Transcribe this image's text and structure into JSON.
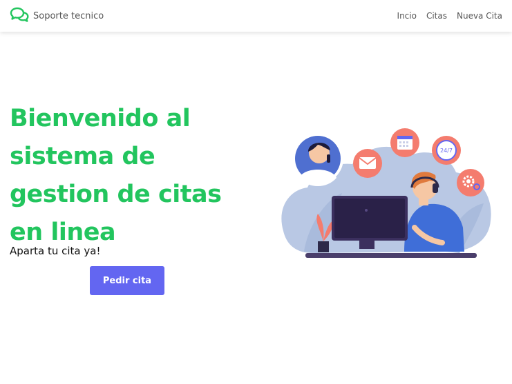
{
  "navbar": {
    "brand_icon": "chat-bubbles-icon",
    "brand_text": "Soporte tecnico",
    "links": [
      "Incio",
      "Citas",
      "Nueva Cita"
    ]
  },
  "hero": {
    "title": "Bienvenido al sistema de gestion de citas en linea",
    "subtitle": "Aparta tu cita ya!",
    "cta_label": "Pedir cita"
  },
  "illustration": {
    "icon_24_7": "24/7"
  },
  "colors": {
    "accent_green": "#22c55e",
    "button_primary": "#6366f1",
    "blob": "#b9c8e4",
    "salmon": "#f47c6e"
  }
}
